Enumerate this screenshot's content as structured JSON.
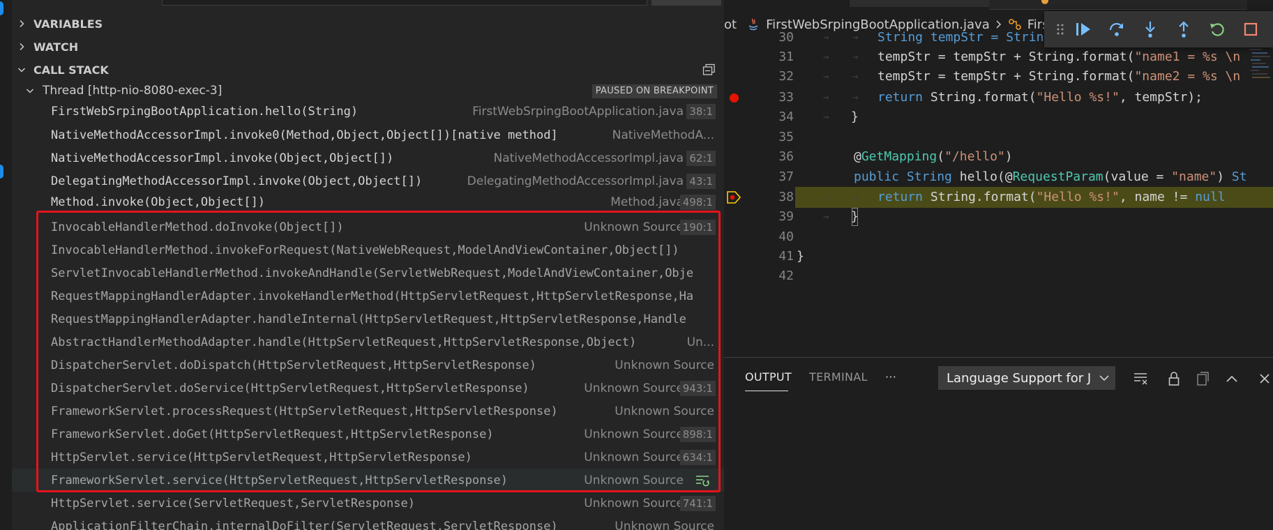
{
  "debug_panel": {
    "sections": [
      {
        "label": "VARIABLES",
        "expanded": false
      },
      {
        "label": "WATCH",
        "expanded": false
      },
      {
        "label": "CALL STACK",
        "expanded": true
      }
    ],
    "thread": {
      "label": "Thread [http-nio-8080-exec-3]",
      "status": "PAUSED ON BREAKPOINT"
    },
    "frames": [
      {
        "fn": "FirstWebSrpingBootApplication.hello(String)",
        "source": "FirstWebSrpingBootApplication.java",
        "line": "38:1"
      },
      {
        "fn": "NativeMethodAccessorImpl.invoke0(Method,Object,Object[])[native method]",
        "source": "NativeMethodA...",
        "line": ""
      },
      {
        "fn": "NativeMethodAccessorImpl.invoke(Object,Object[])",
        "source": "NativeMethodAccessorImpl.java",
        "line": "62:1"
      },
      {
        "fn": "DelegatingMethodAccessorImpl.invoke(Object,Object[])",
        "source": "DelegatingMethodAccessorImpl.java",
        "line": "43:1"
      },
      {
        "fn": "Method.invoke(Object,Object[])",
        "source": "Method.java",
        "line": "498:1"
      },
      {
        "fn": "InvocableHandlerMethod.doInvoke(Object[])",
        "source": "Unknown Source",
        "line": "190:1"
      },
      {
        "fn": "InvocableHandlerMethod.invokeForRequest(NativeWebRequest,ModelAndViewContainer,Object[])",
        "source": "",
        "line": ""
      },
      {
        "fn": "ServletInvocableHandlerMethod.invokeAndHandle(ServletWebRequest,ModelAndViewContainer,Obje",
        "source": "",
        "line": ""
      },
      {
        "fn": "RequestMappingHandlerAdapter.invokeHandlerMethod(HttpServletRequest,HttpServletResponse,Ha",
        "source": "",
        "line": ""
      },
      {
        "fn": "RequestMappingHandlerAdapter.handleInternal(HttpServletRequest,HttpServletResponse,Handle",
        "source": "",
        "line": ""
      },
      {
        "fn": "AbstractHandlerMethodAdapter.handle(HttpServletRequest,HttpServletResponse,Object)",
        "source": "Un...",
        "line": ""
      },
      {
        "fn": "DispatcherServlet.doDispatch(HttpServletRequest,HttpServletResponse)",
        "source": "Unknown Source",
        "line": ""
      },
      {
        "fn": "DispatcherServlet.doService(HttpServletRequest,HttpServletResponse)",
        "source": "Unknown Source",
        "line": "943:1"
      },
      {
        "fn": "FrameworkServlet.processRequest(HttpServletRequest,HttpServletResponse)",
        "source": "Unknown Source",
        "line": ""
      },
      {
        "fn": "FrameworkServlet.doGet(HttpServletRequest,HttpServletResponse)",
        "source": "Unknown Source",
        "line": "898:1"
      },
      {
        "fn": "HttpServlet.service(HttpServletRequest,HttpServletResponse)",
        "source": "Unknown Source",
        "line": "634:1"
      },
      {
        "fn": "FrameworkServlet.service(HttpServletRequest,HttpServletResponse)",
        "source": "Unknown Source",
        "line": ""
      },
      {
        "fn": "HttpServlet.service(ServletRequest,ServletResponse)",
        "source": "Unknown Source",
        "line": "741:1"
      },
      {
        "fn": "ApplicationFilterChain.internalDoFilter(ServletRequest,ServletResponse)",
        "source": "Unknown Source",
        "line": ""
      }
    ]
  },
  "editor": {
    "breadcrumb": [
      "ot",
      "FirstWebSrpingBootApplication.java",
      "Firs"
    ],
    "lines": [
      {
        "n": "30",
        "t0": "String tempStr = String"
      },
      {
        "n": "31",
        "t0": "tempStr = tempStr + String.format(",
        "t1": "\"name1 = %s \\n"
      },
      {
        "n": "32",
        "t0": "tempStr = tempStr + String.format(",
        "t1": "\"name2 = %s \\n"
      },
      {
        "n": "33",
        "t0": "return",
        "t1": " String.format(",
        "t2": "\"Hello %s!\"",
        "t3": ", tempStr);"
      },
      {
        "n": "34",
        "t0": "}"
      },
      {
        "n": "35"
      },
      {
        "n": "36",
        "t0": "@",
        "t1": "GetMapping",
        "t2": "(",
        "t3": "\"/hello\"",
        "t4": ")"
      },
      {
        "n": "37",
        "t0": "public",
        "t1": " String",
        "t2": " hello(@",
        "t3": "RequestParam",
        "t4": "(value = ",
        "t5": "\"name\"",
        "t6": ") ",
        "t7": "St"
      },
      {
        "n": "38",
        "t0": "return",
        "t1": " String.format(",
        "t2": "\"Hello %s!\"",
        "t3": ", name != ",
        "t4": "null"
      },
      {
        "n": "39",
        "t0": "}"
      },
      {
        "n": "40"
      },
      {
        "n": "41",
        "t0": "}"
      },
      {
        "n": "42"
      }
    ]
  },
  "output_panel": {
    "tabs": [
      "OUTPUT",
      "TERMINAL",
      "···"
    ],
    "channel": "Language Support for J"
  },
  "colors": {
    "accent_blue": "#1c8de8",
    "highlight_box": "#e5141a",
    "breakpoint": "#e51400",
    "current_line": "#4b4b18",
    "continue_icon": "#75beff",
    "restart_icon": "#89d185",
    "stop_icon": "#f48771"
  }
}
